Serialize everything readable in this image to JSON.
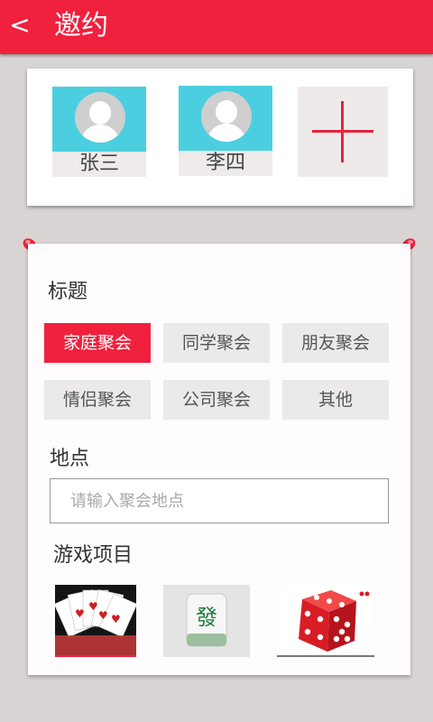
{
  "header": {
    "back_icon": "<",
    "title": "邀约"
  },
  "members": [
    {
      "name": "张三"
    },
    {
      "name": "李四"
    }
  ],
  "form": {
    "title_label": "标题",
    "tags": [
      "家庭聚会",
      "同学聚会",
      "朋友聚会",
      "情侣聚会",
      "公司聚会",
      "其他"
    ],
    "selected_tag": "家庭聚会",
    "location_label": "地点",
    "location_placeholder": "请输入聚会地点",
    "games_label": "游戏项目",
    "games": [
      {
        "name": "playing-cards",
        "icon": "cards-icon"
      },
      {
        "name": "mahjong",
        "icon": "mahjong-tile-icon",
        "text": "發"
      },
      {
        "name": "dice",
        "icon": "dice-icon"
      }
    ]
  },
  "colors": {
    "accent": "#f0213d",
    "avatar_bg": "#4bcfe0",
    "background": "#d9d4d4"
  }
}
